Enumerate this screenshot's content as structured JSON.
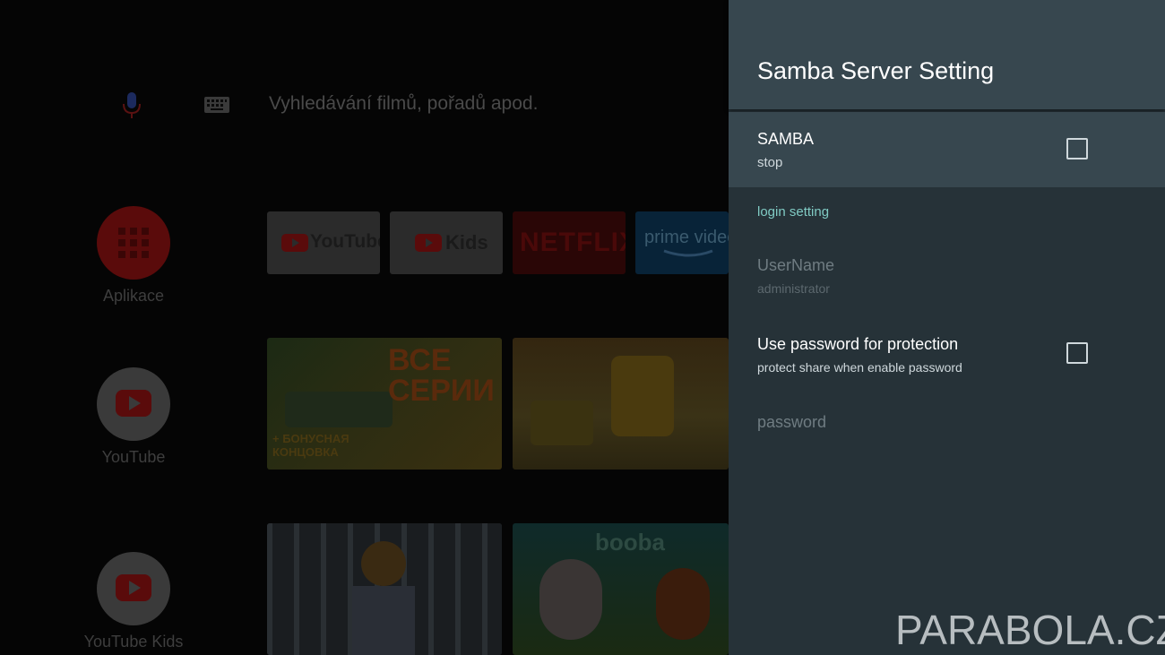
{
  "background": {
    "search_placeholder": "Vyhledávání filmů, pořadů apod.",
    "sidebar": [
      {
        "label": "Aplikace",
        "icon": "apps-grid-icon",
        "color": "#5a0b0b"
      },
      {
        "label": "YouTube",
        "icon": "youtube-icon",
        "color": "#3a3a3a"
      },
      {
        "label": "YouTube Kids",
        "icon": "youtube-kids-icon",
        "color": "#3a3a3a"
      }
    ],
    "apps": [
      {
        "label": "YouTube",
        "icon": "youtube-logo"
      },
      {
        "label": "Kids",
        "icon": "youtube-kids-logo"
      },
      {
        "label": "NETFLIX",
        "icon": "netflix-logo"
      },
      {
        "label": "prime video",
        "icon": "prime-video-logo"
      }
    ],
    "thumbnails": [
      {
        "text": "ВСЕ СЕРИИ",
        "subtext": "+ БОНУСНАЯ КОНЦОВКА"
      },
      {
        "text": ""
      },
      {
        "text": ""
      },
      {
        "text": "booba"
      }
    ]
  },
  "panel": {
    "title": "Samba Server Setting",
    "samba": {
      "title": "SAMBA",
      "summary": "stop",
      "checked": false
    },
    "category": "login setting",
    "username": {
      "title": "UserName",
      "summary": "administrator"
    },
    "use_password": {
      "title": "Use password for protection",
      "summary": "protect share when enable password",
      "checked": false
    },
    "password": {
      "title": "password"
    }
  },
  "watermark": "PARABOLA.CZ",
  "colors": {
    "panel_bg": "#263238",
    "header_bg": "#37474f",
    "accent": "#80cbc4",
    "text_primary": "#ffffff",
    "text_disabled": "#6f7c82"
  }
}
